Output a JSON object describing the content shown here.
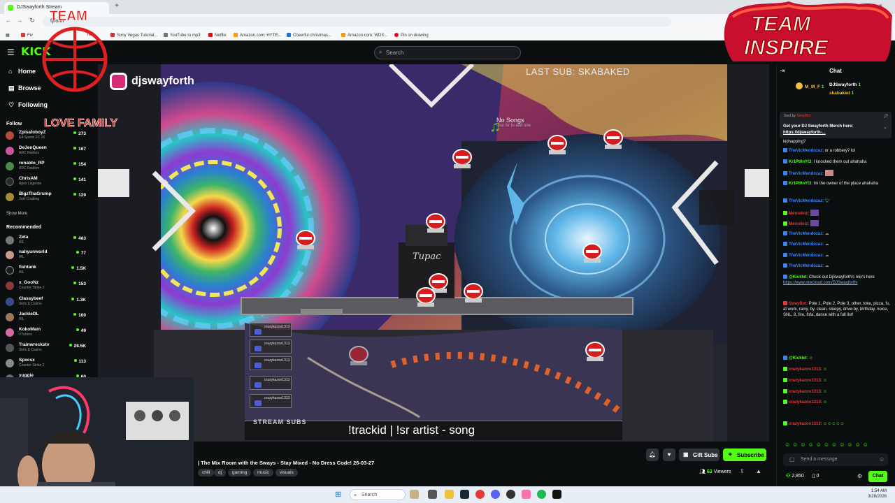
{
  "browser": {
    "tab_title": "DJSwayforth Stream",
    "url_text": "fyforth",
    "bookmarks": [
      {
        "label": "Fiv",
        "color": "#e53935"
      },
      {
        "label": "nail",
        "color": "#888888"
      },
      {
        "label": "Sony Vegas Tutorial...",
        "color": "#d32f2f"
      },
      {
        "label": "YouTube to mp3",
        "color": "#777777"
      },
      {
        "label": "Netflix",
        "color": "#e50914"
      },
      {
        "label": "Amazon.com: HYTE...",
        "color": "#ff9900"
      },
      {
        "label": "Cheerful christmas...",
        "color": "#1976d2"
      },
      {
        "label": "Amazon.com: WDX...",
        "color": "#ff9900"
      },
      {
        "label": "Pin on drawing",
        "color": "#e60023"
      }
    ]
  },
  "kick": {
    "logo": "KICK",
    "search_placeholder": "Search"
  },
  "sidebar": {
    "nav": [
      {
        "label": "Home",
        "icon": "home-icon"
      },
      {
        "label": "Browse",
        "icon": "browse-icon"
      },
      {
        "label": "Following",
        "icon": "heart-icon"
      }
    ],
    "following_heading": "Follow",
    "following": [
      {
        "name": "ZpisafoboyZ",
        "category": "EA Sports FC 26",
        "viewers": "273",
        "color": "#b54b3a"
      },
      {
        "name": "DeJenQueen",
        "category": "ARC Raiders",
        "viewers": "167",
        "color": "#c7579b"
      },
      {
        "name": "ronaldo_RP",
        "category": "ARC Raiders",
        "viewers": "154",
        "color": "#4a8a4a"
      },
      {
        "name": "ChrisAM",
        "category": "Apex Legends",
        "viewers": "141",
        "color": "#2b2b2b"
      },
      {
        "name": "BigzThaGrump",
        "category": "Just Chatting",
        "viewers": "129",
        "color": "#a68a3a"
      }
    ],
    "show_more": "Show More",
    "recommended_heading": "Recommended",
    "recommended": [
      {
        "name": "Zeta",
        "category": "IRL",
        "viewers": "483",
        "color": "#777777"
      },
      {
        "name": "nahyunworld",
        "category": "IRL",
        "viewers": "77",
        "color": "#c99a8a"
      },
      {
        "name": "fishtank",
        "category": "IRL",
        "viewers": "1.5K",
        "color": "#1b1b1b"
      },
      {
        "name": "x_GooNz",
        "category": "Counter-Strike 2",
        "viewers": "153",
        "color": "#8a3a3a"
      },
      {
        "name": "Classybeef",
        "category": "Slots & Casino",
        "viewers": "1.3K",
        "color": "#3a4a8a"
      },
      {
        "name": "JackieDL",
        "category": "IRL",
        "viewers": "100",
        "color": "#9a7a5a"
      },
      {
        "name": "KokoMain",
        "category": "VTubers",
        "viewers": "49",
        "color": "#d66aa0"
      },
      {
        "name": "Trainwreckstv",
        "category": "Slots & Casino",
        "viewers": "28.5K",
        "color": "#555555"
      },
      {
        "name": "Spxcsx",
        "category": "Counter-Strike 2",
        "viewers": "113",
        "color": "#8a8a8a"
      },
      {
        "name": "yuggie",
        "category": "",
        "viewers": "60",
        "color": "#6a6a6a"
      }
    ]
  },
  "player": {
    "last_sub": "LAST SUB: SKABAKED",
    "instagram_handle": "djswayforth",
    "now_playing_title": "No Songs",
    "now_playing_sub": "Use !sr to add one",
    "stream_subs_label": "STREAM SUBS",
    "trackid_text": "!trackid | !sr artist - song",
    "sub_rows": [
      "crazykazoo1313",
      "crazykazoo1313",
      "crazykazoo1313",
      "crazykazoo1313",
      "crazykazoo1313"
    ],
    "overlay_team_text": "TEAM INSPIRE",
    "overlay_love_family": "LOVE FAMILY"
  },
  "stream_info": {
    "title": "| The Mix Room with the Sways - Stay Mixed - No Dress Code! 26-03-27",
    "tags": [
      "chill",
      "dj",
      "gaming",
      "music",
      "visuals"
    ],
    "gift_subs_label": "Gift Subs",
    "subscribe_label": "Subscribe",
    "viewers_count": "63",
    "viewers_label": "Viewers"
  },
  "chat": {
    "header": "Chat",
    "top_gifters": [
      {
        "name": "M_M_F",
        "count": "1"
      },
      {
        "name": "DJSwayforth",
        "count": "1"
      },
      {
        "name": "skabaked",
        "count": "1"
      }
    ],
    "pinned": {
      "sender_label": "Sent by",
      "sender": "SwayBot",
      "text": "Get your DJ Swayforth Merch here:",
      "link": "https://djswayforth-..."
    },
    "messages": [
      {
        "user": "",
        "text": "kidnapping?",
        "color": "#efeff1"
      },
      {
        "user": "TheVicMendozaz",
        "text": "or a robbery? lol",
        "color": "#3d83f5"
      },
      {
        "user": "Kr1Pt0nYt3",
        "text": "I knocked them out ahahaha",
        "color": "#53fc18"
      },
      {
        "user": "TheVicMendozaz",
        "text": "",
        "color": "#3d83f5"
      },
      {
        "user": "Kr1Pt0nYt3",
        "text": "Im the owner of the place ahahaha",
        "color": "#53fc18"
      },
      {
        "user": "TheVicMendozaz",
        "text": "",
        "color": "#3d83f5"
      },
      {
        "user": "Merceloiz",
        "text": "",
        "color": "#e53935"
      },
      {
        "user": "Merceloiz",
        "text": "",
        "color": "#e53935"
      },
      {
        "user": "TheVicMendozaz",
        "text": "",
        "color": "#3d83f5"
      },
      {
        "user": "TheVicMendozaz",
        "text": "",
        "color": "#3d83f5"
      },
      {
        "user": "TheVicMendozaz",
        "text": "",
        "color": "#3d83f5"
      },
      {
        "user": "TheVicMendozaz",
        "text": "",
        "color": "#3d83f5"
      },
      {
        "user": "@Kicklet",
        "text": "Check out DjSwayforth's mix's here",
        "link": "https://www.mixcloud.com/DJSwayforth/",
        "color": "#53fc18"
      },
      {
        "user": "SwayBot",
        "text": "Pole 1, Pole 2, Pole 3, other, toke, pizza, fu, at work, rainy, by, clean, sleepy, drive-by, birthday, noice, SNL, 8, fire, fofa, dance with a full list!",
        "color": "#e53935"
      },
      {
        "user": "@Kicklet",
        "text": "",
        "color": "#53fc18"
      },
      {
        "user": "crazykazoo1313",
        "text": "",
        "color": "#e53935"
      },
      {
        "user": "crazykazoo1313",
        "text": "",
        "color": "#e53935"
      },
      {
        "user": "crazykazoo1313",
        "text": "",
        "color": "#e53935"
      },
      {
        "user": "crazykazoo1313",
        "text": "",
        "color": "#e53935"
      },
      {
        "user": "crazykazoo1313",
        "text": "",
        "color": "#e53935"
      }
    ],
    "input_placeholder": "Send a message",
    "points": "2,850",
    "points_secondary": "0",
    "chat_button": "Chat"
  },
  "taskbar": {
    "search_label": "Search",
    "time": "1:54 AM",
    "date": "3/28/2026"
  }
}
